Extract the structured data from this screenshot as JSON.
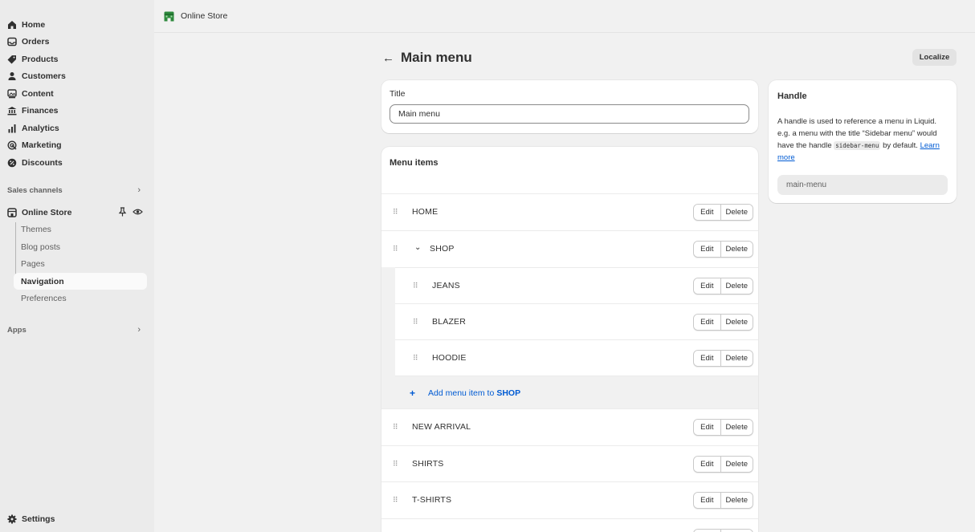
{
  "sidebar": {
    "primary": [
      {
        "label": "Home",
        "icon": "home-icon"
      },
      {
        "label": "Orders",
        "icon": "inbox-icon"
      },
      {
        "label": "Products",
        "icon": "tag-icon"
      },
      {
        "label": "Customers",
        "icon": "person-icon"
      },
      {
        "label": "Content",
        "icon": "image-icon"
      },
      {
        "label": "Finances",
        "icon": "bank-icon"
      },
      {
        "label": "Analytics",
        "icon": "bar-chart-icon"
      },
      {
        "label": "Marketing",
        "icon": "target-icon"
      },
      {
        "label": "Discounts",
        "icon": "discount-icon"
      }
    ],
    "sales_channels_label": "Sales channels",
    "online_store": {
      "label": "Online Store",
      "sub_items": [
        "Themes",
        "Blog posts",
        "Pages",
        "Navigation",
        "Preferences"
      ],
      "active": "Navigation"
    },
    "apps_label": "Apps",
    "settings_label": "Settings"
  },
  "topbar": {
    "title": "Online Store"
  },
  "page": {
    "title": "Main menu",
    "localize_label": "Localize"
  },
  "title_card": {
    "label": "Title",
    "value": "Main menu"
  },
  "menu_card": {
    "title": "Menu items",
    "edit_label": "Edit",
    "delete_label": "Delete",
    "items": [
      {
        "label": "HOME"
      },
      {
        "label": "SHOP",
        "expanded": true,
        "children": [
          {
            "label": "JEANS"
          },
          {
            "label": "BLAZER"
          },
          {
            "label": "HOODIE"
          }
        ]
      },
      {
        "label": "NEW ARRIVAL"
      },
      {
        "label": "SHIRTS"
      },
      {
        "label": "T-SHIRTS"
      }
    ],
    "add_prefix": "Add menu item to",
    "add_target": "SHOP"
  },
  "handle_card": {
    "title": "Handle",
    "desc_1": "A handle is used to reference a menu in Liquid. e.g. a menu with the title “Sidebar menu” would have the handle",
    "code": "sidebar-menu",
    "desc_2": "by default.",
    "learn_more": "Learn more",
    "value": "main-menu"
  },
  "colors": {
    "accent": "#005bd3",
    "sidebar_bg": "#ebebeb",
    "page_bg": "#f1f1f1",
    "store_icon": "#2e8a3d"
  }
}
